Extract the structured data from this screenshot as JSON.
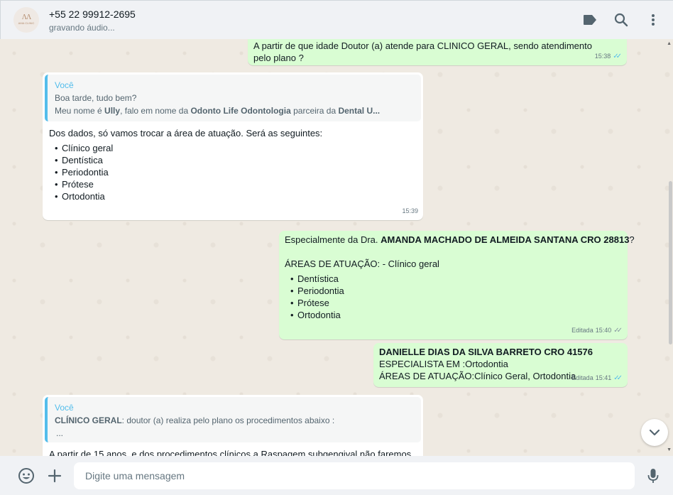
{
  "header": {
    "avatar_text": "AMA CLINIC",
    "contact_name": "+55 22 99912-2695",
    "status": "gravando áudio..."
  },
  "messages": {
    "m1": {
      "text": " A partir de que idade Doutor (a) atende para CLINICO GERAL, sendo atendimento pelo plano ?",
      "time": "15:38"
    },
    "m2": {
      "quote_author": "Você",
      "quote_line1": "Boa tarde, tudo bem?",
      "quote_line2_a": "Meu nome é ",
      "quote_line2_b": "Ully",
      "quote_line2_c": ", falo em nome da ",
      "quote_line2_d": "Odonto Life Odontologia",
      "quote_line2_e": " parceira da ",
      "quote_line2_f": "Dental U...",
      "body": "Dos dados, só vamos trocar a área de atuação. Será as seguintes:",
      "items": [
        "Clínico geral",
        "Dentística",
        "Periodontia",
        "Prótese",
        "Ortodontia"
      ],
      "time": "15:39"
    },
    "m3": {
      "line1_a": "Especialmente da Dra. ",
      "line1_b": "AMANDA MACHADO DE ALMEIDA SANTANA CRO 28813",
      "line1_c": "?",
      "line2": "ÁREAS DE ATUAÇÃO: - Clínico geral",
      "items": [
        "Dentística",
        "Periodontia",
        "Prótese",
        "Ortodontia"
      ],
      "edited": "Editada",
      "time": "15:40"
    },
    "m4": {
      "line1": "DANIELLE DIAS DA SILVA BARRETO CRO 41576",
      "line2": "ESPECIALISTA EM :Ortodontia",
      "line3": "ÁREAS DE ATUAÇÃO:Clínico Geral, Ortodontia",
      "edited": "Editada",
      "time": "15:41"
    },
    "m5": {
      "quote_author": "Você",
      "quote_line1_a": "CLÍNICO GERAL",
      "quote_line1_b": ":  doutor (a) realiza pelo plano os procedimentos abaixo :",
      "quote_line2": "...",
      "body": "A partir de 15 anos, e dos procedimentos clínicos a Raspagem subgengival não faremos"
    }
  },
  "footer": {
    "placeholder": "Digite uma mensagem"
  },
  "colors": {
    "outgoing": "#d9fdd3",
    "incoming": "#ffffff",
    "read_ticks": "#53bdeb",
    "quote_accent": "#53bdeb"
  },
  "icons": [
    "label-icon",
    "search-icon",
    "menu-icon",
    "emoji-icon",
    "plus-icon",
    "mic-icon",
    "chevron-down-icon"
  ]
}
